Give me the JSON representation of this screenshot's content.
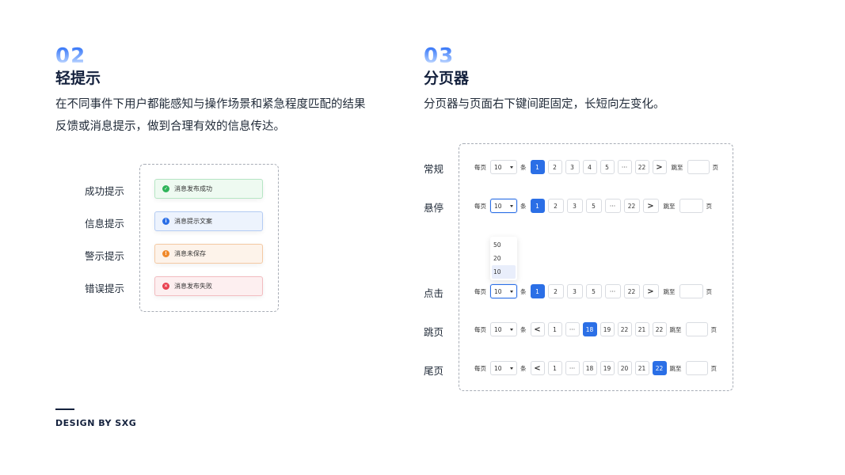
{
  "left": {
    "number": "02",
    "title": "轻提示",
    "desc_line1": "在不同事件下用户都能感知与操作场景和紧急程度匹配的结果",
    "desc_line2": "反馈或消息提示，做到合理有效的信息传达。",
    "toasts": [
      {
        "label": "成功提示",
        "message": "消息发布成功",
        "icon": "check-circle-icon",
        "icon_glyph": "✓",
        "color": "#2fb45a"
      },
      {
        "label": "信息提示",
        "message": "消息提示文案",
        "icon": "info-circle-icon",
        "icon_glyph": "i",
        "color": "#2b6fe6"
      },
      {
        "label": "警示提示",
        "message": "消息未保存",
        "icon": "warning-circle-icon",
        "icon_glyph": "!",
        "color": "#f0892b"
      },
      {
        "label": "错误提示",
        "message": "消息发布失败",
        "icon": "error-circle-icon",
        "icon_glyph": "✕",
        "color": "#e9404f"
      }
    ]
  },
  "right": {
    "number": "03",
    "title": "分页器",
    "desc": "分页器与页面右下键间距固定，长短向左变化。",
    "common": {
      "per_page": "每页",
      "unit": "条",
      "jump": "跳至",
      "page": "页",
      "size_value": "10",
      "ellipsis": "···",
      "prev_glyph": "<",
      "next_glyph": ">"
    },
    "rows": [
      {
        "label": "常规",
        "pages": [
          "1",
          "2",
          "3",
          "4",
          "5",
          "···",
          "22"
        ],
        "current": "1"
      },
      {
        "label": "悬停",
        "pages": [
          "1",
          "2",
          "3",
          "5",
          "···",
          "22"
        ],
        "current": "1"
      },
      {
        "label": "点击",
        "pages": [
          "1",
          "2",
          "3",
          "5",
          "···",
          "22"
        ],
        "current": "1"
      },
      {
        "label": "跳页",
        "pages": [
          "1",
          "···",
          "18",
          "19",
          "22",
          "21",
          "22"
        ],
        "current": "18"
      },
      {
        "label": "尾页",
        "pages": [
          "1",
          "···",
          "18",
          "19",
          "20",
          "21",
          "22"
        ],
        "current": "22"
      }
    ],
    "dropdown_options": [
      "50",
      "20",
      "10"
    ],
    "dropdown_selected": "10"
  },
  "brand": "DESIGN BY SXG",
  "colors": {
    "primary": "#2b6fe6",
    "text_dark": "#14213d",
    "dashed_border": "#a8adb6"
  }
}
